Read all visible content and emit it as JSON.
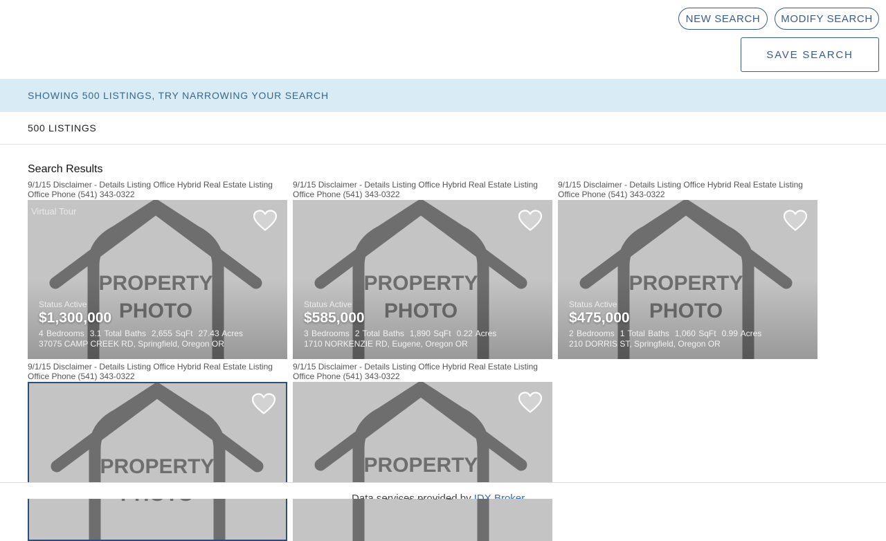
{
  "actions": {
    "new_search": "NEW SEARCH",
    "modify_search": "MODIFY SEARCH",
    "save_search": "SAVE SEARCH"
  },
  "notice": "SHOWING 500 LISTINGS, TRY NARROWING YOUR SEARCH",
  "listing_count": "500 LISTINGS",
  "results_title": "Search Results",
  "placeholder_text": {
    "line1": "PROPERTY",
    "line2": "PHOTO"
  },
  "listings": [
    {
      "disclaimer_line1": "9/1/15 Disclaimer - Details Listing Office Hybrid Real Estate Listing",
      "disclaimer_line2": "Office Phone (541) 343-0322",
      "virtual_tour": "Virtual Tour",
      "status": "Status Active",
      "price": "$1,300,000",
      "beds": "4 Bedrooms",
      "baths": "3.1 Total Baths",
      "sqft": "2,655 SqFt",
      "acres": "27.43 Acres",
      "address": "37075 CAMP CREEK RD, Springfield, Oregon OR"
    },
    {
      "disclaimer_line1": "9/1/15 Disclaimer - Details Listing Office Hybrid Real Estate Listing",
      "disclaimer_line2": "Office Phone (541) 343-0322",
      "status": "Status Active",
      "price": "$585,000",
      "beds": "3 Bedrooms",
      "baths": "2 Total Baths",
      "sqft": "1,890 SqFt",
      "acres": "0.22 Acres",
      "address": "1710 NORKENZIE RD, Eugene, Oregon OR"
    },
    {
      "disclaimer_line1": "9/1/15 Disclaimer - Details Listing Office Hybrid Real Estate Listing",
      "disclaimer_line2": "Office Phone (541) 343-0322",
      "status": "Status Active",
      "price": "$475,000",
      "beds": "2 Bedrooms",
      "baths": "1 Total Baths",
      "sqft": "1,060 SqFt",
      "acres": "0.99 Acres",
      "address": "210 DORRIS ST, Springfield, Oregon OR"
    },
    {
      "disclaimer_line1": "9/1/15 Disclaimer - Details Listing Office Hybrid Real Estate Listing",
      "disclaimer_line2": "Office Phone (541) 343-0322"
    },
    {
      "disclaimer_line1": "9/1/15 Disclaimer - Details Listing Office Hybrid Real Estate Listing",
      "disclaimer_line2": "Office Phone (541) 343-0322"
    }
  ],
  "footer": {
    "credit_prefix": "Data services provided by",
    "credit_link": "IDX Broker"
  },
  "colors": {
    "accent": "#3d5a8c",
    "notice_bg": "#d9ebf4",
    "notice_text": "#37678c",
    "placeholder_bg": "#c4c4c4",
    "placeholder_house": "#6e6e6e"
  }
}
